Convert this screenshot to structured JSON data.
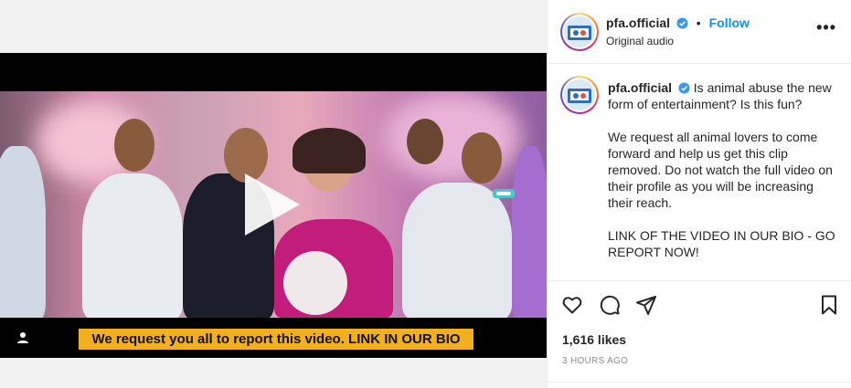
{
  "post": {
    "username": "pfa.official",
    "follow_label": "Follow",
    "audio_label": "Original audio",
    "more_label": "•••",
    "dot": "•"
  },
  "video": {
    "caption": "We request you all to report this video. LINK IN OUR BIO"
  },
  "caption": {
    "username": "pfa.official",
    "line1": "Is animal abuse the new form of entertainment? Is this fun?",
    "para2": "We request all animal lovers to come forward and help us get this clip removed. Do not watch the full video on their profile as you will be increasing their reach.",
    "para3": "LINK OF THE VIDEO IN OUR BIO - GO REPORT NOW!"
  },
  "stats": {
    "likes": "1,616 likes",
    "time": "3 HOURS AGO"
  },
  "icons": {
    "like": "heart-icon",
    "comment": "comment-icon",
    "share": "share-icon",
    "save": "bookmark-icon",
    "play": "play-icon",
    "verified": "verified-badge-icon",
    "more": "more-options-icon"
  },
  "colors": {
    "follow": "#0095f6",
    "verified": "#3897f0",
    "caption_bg": "#f2b01e"
  }
}
